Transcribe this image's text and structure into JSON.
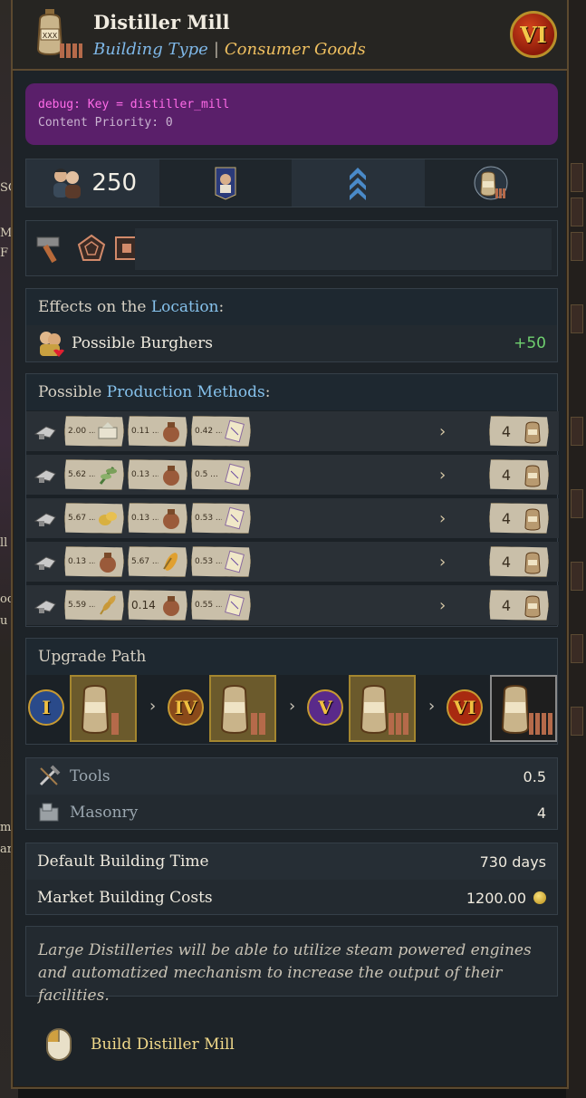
{
  "header": {
    "title": "Distiller Mill",
    "type_label": "Building Type",
    "separator": "|",
    "category": "Consumer Goods",
    "tier": "VI",
    "icon": "jug-icon"
  },
  "debug": {
    "key_line": "debug: Key = distiller_mill",
    "priority_line": "Content Priority: 0"
  },
  "stats": {
    "population": "250",
    "icons": [
      "workers-icon",
      "noble-flag-icon",
      "rank-chevrons-icon",
      "building-jug-icon"
    ]
  },
  "tags": {
    "icons": [
      "hammer-icon",
      "pentagon-icon",
      "square-icon"
    ]
  },
  "effects": {
    "title_prefix": "Effects on the ",
    "title_highlight": "Location",
    "title_suffix": ":",
    "rows": [
      {
        "label": "Possible Burghers",
        "value": "+50",
        "icon": "burghers-icon"
      }
    ]
  },
  "methods": {
    "title_prefix": "Possible ",
    "title_highlight": "Production Methods",
    "title_suffix": ":",
    "rows": [
      {
        "inputs": [
          {
            "v": "2.00 ...",
            "icon": "sugar-icon"
          },
          {
            "v": "0.11 ...",
            "icon": "pottery-icon"
          },
          {
            "v": "0.42 ...",
            "icon": "paper-icon"
          }
        ],
        "output": "4"
      },
      {
        "inputs": [
          {
            "v": "5.62 ...",
            "icon": "herbs-icon"
          },
          {
            "v": "0.13 ...",
            "icon": "pottery-icon"
          },
          {
            "v": "0.5 ...",
            "icon": "paper-icon"
          }
        ],
        "output": "4"
      },
      {
        "inputs": [
          {
            "v": "5.67 ...",
            "icon": "potato-icon"
          },
          {
            "v": "0.13 ...",
            "icon": "pottery-icon"
          },
          {
            "v": "0.53 ...",
            "icon": "paper-icon"
          }
        ],
        "output": "4"
      },
      {
        "inputs": [
          {
            "v": "0.13 ...",
            "icon": "pottery-icon"
          },
          {
            "v": "5.67 ...",
            "icon": "maize-icon"
          },
          {
            "v": "0.53 ...",
            "icon": "paper-icon"
          }
        ],
        "output": "4"
      },
      {
        "inputs": [
          {
            "v": "5.59 ...",
            "icon": "wheat-icon"
          },
          {
            "v": "0.14",
            "icon": "pottery-icon"
          },
          {
            "v": "0.55 ...",
            "icon": "paper-icon"
          }
        ],
        "output": "4"
      }
    ]
  },
  "upgrade": {
    "title": "Upgrade Path",
    "tiers": [
      "I",
      "IV",
      "V",
      "VI"
    ]
  },
  "resources": [
    {
      "label": "Tools",
      "value": "0.5",
      "icon": "tools-icon"
    },
    {
      "label": "Masonry",
      "value": "4",
      "icon": "masonry-icon"
    }
  ],
  "costs": [
    {
      "label": "Default Building Time",
      "value": "730 days"
    },
    {
      "label": "Market Building Costs",
      "value": "1200.00"
    }
  ],
  "description": "Large Distilleries will be able to utilize steam powered engines and automatized mechanism to increase the output of their facilities.",
  "build": {
    "label": "Build Distiller Mill",
    "icon": "mouse-icon"
  },
  "background_fragments": [
    "SO",
    "M",
    "F",
    "ll",
    "oo",
    "u",
    "m",
    "ar"
  ]
}
